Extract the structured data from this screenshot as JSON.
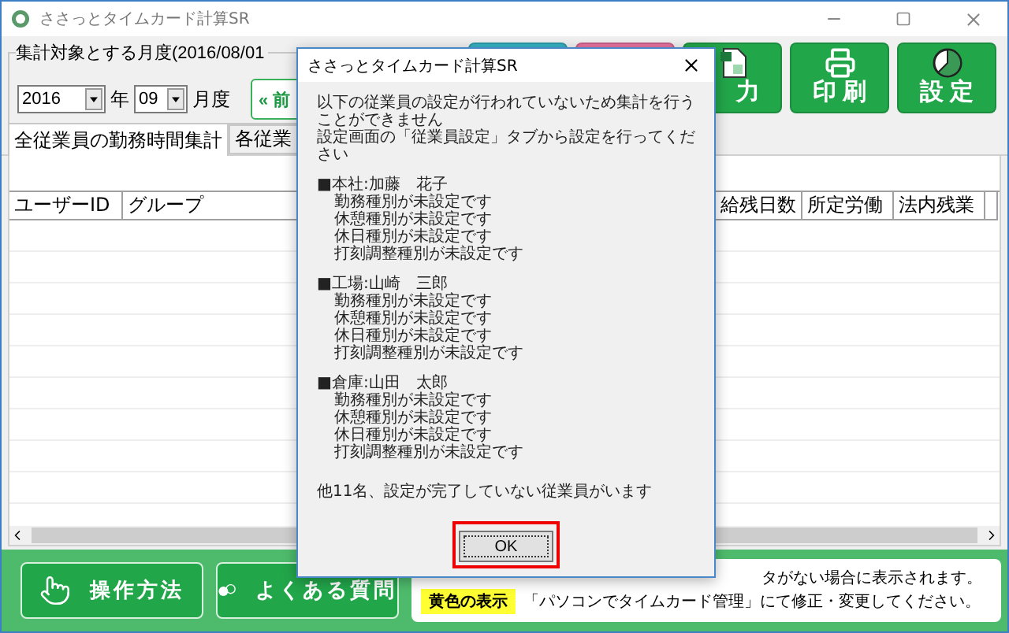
{
  "window": {
    "title": "ささっとタイムカード計算SR"
  },
  "period": {
    "label": "集計対象とする月度(2016/08/01",
    "year": "2016",
    "year_unit": "年",
    "month": "09",
    "month_unit": "月度",
    "prev_button": "« 前"
  },
  "toolbar": [
    {
      "kind": "plain",
      "color": "#35b3c4"
    },
    {
      "kind": "plain",
      "color": "#e8739f"
    },
    {
      "kind": "excel",
      "label": "力",
      "color": "#22a64a"
    },
    {
      "kind": "print",
      "label": "印 刷",
      "color": "#22a64a"
    },
    {
      "kind": "settings",
      "label": "設 定",
      "color": "#22a64a"
    }
  ],
  "tabs": [
    {
      "label": "全従業員の勤務時間集計",
      "selected": true
    },
    {
      "label": "各従業",
      "selected": false
    }
  ],
  "table": {
    "columns": [
      "ユーザーID",
      "グループ",
      "給残日数",
      "所定労働",
      "法内残業"
    ]
  },
  "footer": {
    "buttons": [
      {
        "kind": "howto",
        "label": "操作方法"
      },
      {
        "kind": "faq",
        "label": "よくある質問"
      }
    ],
    "note": {
      "tag": "黄色の表示",
      "lines": [
        "タがない場合に表示されます。",
        "「パソコンでタイムカード管理」にて修正・変更してください。"
      ]
    }
  },
  "dialog": {
    "title": "ささっとタイムカード計算SR",
    "intro": [
      "以下の従業員の設定が行われていないため集計を行うことができません",
      "設定画面の「従業員設定」タブから設定を行ってください"
    ],
    "employees": [
      {
        "name": "■本社:加藤　花子",
        "issues": [
          "勤務種別が未設定です",
          "休憩種別が未設定です",
          "休日種別が未設定です",
          "打刻調整種別が未設定です"
        ]
      },
      {
        "name": "■工場:山崎　三郎",
        "issues": [
          "勤務種別が未設定です",
          "休憩種別が未設定です",
          "休日種別が未設定です",
          "打刻調整種別が未設定です"
        ]
      },
      {
        "name": "■倉庫:山田　太郎",
        "issues": [
          "勤務種別が未設定です",
          "休憩種別が未設定です",
          "休日種別が未設定です",
          "打刻調整種別が未設定です"
        ]
      }
    ],
    "summary": "他11名、設定が完了していない従業員がいます",
    "ok": "OK"
  }
}
